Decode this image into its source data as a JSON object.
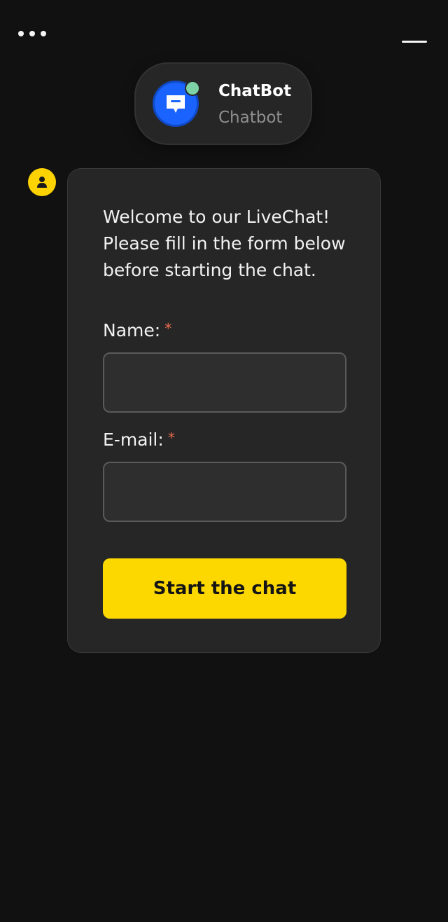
{
  "header": {
    "menu_icon": "more-dots-icon",
    "minimize_icon": "minimize-icon"
  },
  "agent": {
    "name": "ChatBot",
    "role": "Chatbot",
    "avatar_icon": "chat-bubble-icon",
    "status_color": "#7dd3a5",
    "avatar_color": "#1b63ff"
  },
  "message": {
    "avatar_icon": "user-icon",
    "avatar_color": "#fcd200",
    "welcome_text": "Welcome to our LiveChat! Please fill in the form below before starting the chat."
  },
  "form": {
    "name_label": "Name:",
    "name_value": "",
    "email_label": "E-mail:",
    "email_value": "",
    "required_mark": "*",
    "submit_label": "Start the chat",
    "accent_color": "#fcd800"
  }
}
